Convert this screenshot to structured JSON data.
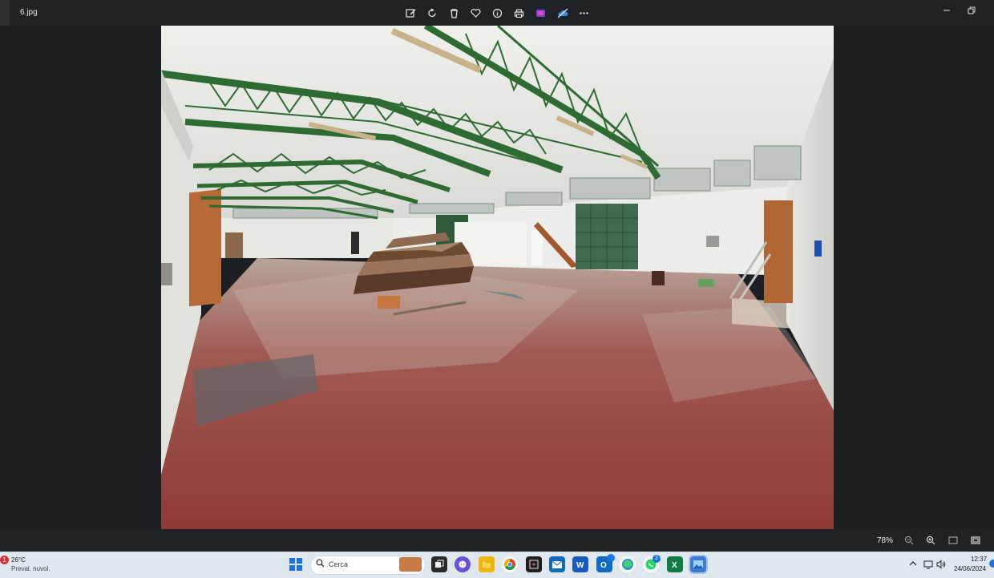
{
  "window": {
    "filename": "6.jpg"
  },
  "toolbar": {
    "icons": [
      "edit-image-icon",
      "rotate-icon",
      "delete-icon",
      "favorite-icon",
      "info-icon",
      "print-icon",
      "clipchamp-icon",
      "onedrive-icon",
      "more-icon"
    ]
  },
  "statusbar": {
    "zoom": "78%"
  },
  "taskbar": {
    "weather": {
      "badge": "1",
      "temp": "26°C",
      "desc": "Preval. nuvol."
    },
    "search": {
      "label": "Cerca"
    },
    "badges": {
      "outlook": "",
      "whatsapp": "2"
    },
    "clock": {
      "time": "12:37",
      "date": "24/06/2024"
    }
  },
  "colors": {
    "accent": "#1a73e8",
    "floor": "#8f3a35",
    "truss": "#2e6b33"
  }
}
